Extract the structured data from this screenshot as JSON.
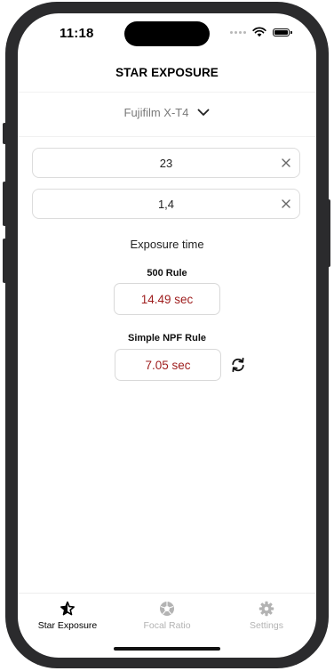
{
  "status": {
    "time": "11:18",
    "icons": [
      "signal-dots-icon",
      "wifi-icon",
      "battery-icon"
    ]
  },
  "nav": {
    "title": "STAR EXPOSURE"
  },
  "camera": {
    "selected": "Fujifilm X-T4",
    "icon": "chevron-down-icon"
  },
  "inputs": {
    "focal_length": "23",
    "aperture": "1,4",
    "clear_icon": "close-icon"
  },
  "exposure": {
    "heading": "Exposure time",
    "rule500": {
      "label": "500 Rule",
      "value": "14.49 sec"
    },
    "npf": {
      "label": "Simple NPF Rule",
      "value": "7.05 sec",
      "toggle_icon": "refresh-icon"
    },
    "value_color": "#9e1c1c"
  },
  "tabbar": {
    "active_color": "#000000",
    "inactive_color": "#b3b3b3",
    "items": [
      {
        "label": "Star Exposure",
        "icon": "star-icon",
        "active": true
      },
      {
        "label": "Focal Ratio",
        "icon": "aperture-icon",
        "active": false
      },
      {
        "label": "Settings",
        "icon": "gear-icon",
        "active": false
      }
    ]
  }
}
